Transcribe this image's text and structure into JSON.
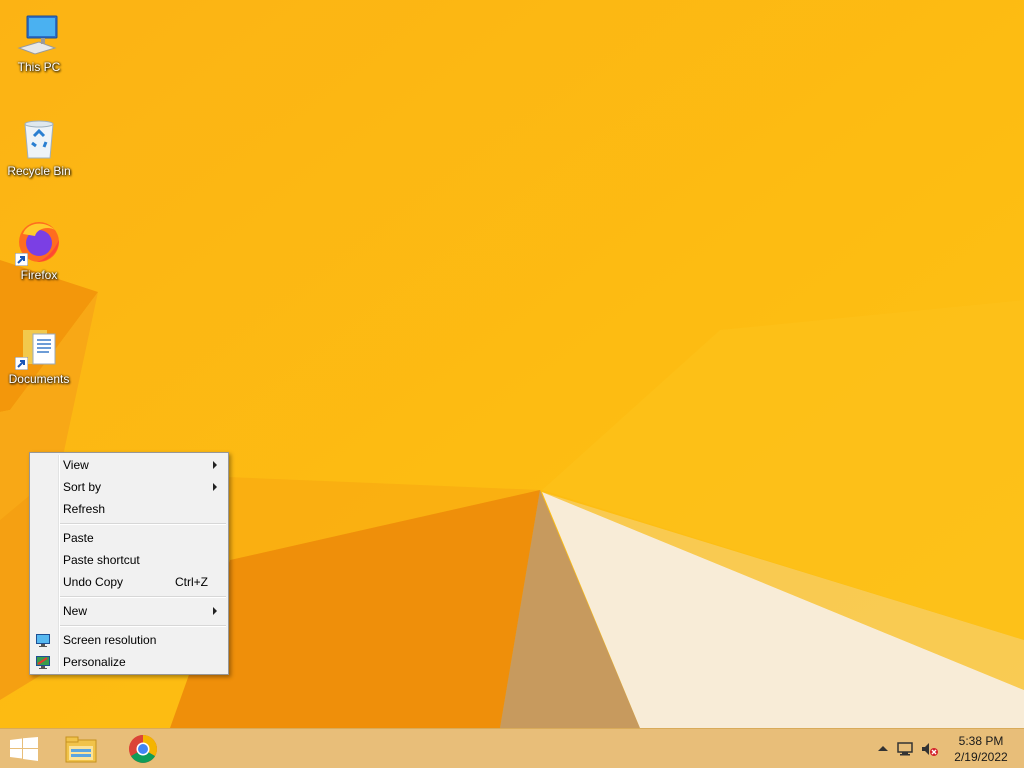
{
  "desktop": {
    "icons": [
      {
        "label": "This PC",
        "icon": "computer-icon"
      },
      {
        "label": "Recycle Bin",
        "icon": "recycle-bin-icon"
      },
      {
        "label": "Firefox",
        "icon": "firefox-icon"
      },
      {
        "label": "Documents",
        "icon": "documents-icon"
      }
    ]
  },
  "context_menu": {
    "items": [
      {
        "label": "View",
        "submenu": true
      },
      {
        "label": "Sort by",
        "submenu": true
      },
      {
        "label": "Refresh"
      },
      {
        "label": "Paste"
      },
      {
        "label": "Paste shortcut"
      },
      {
        "label": "Undo Copy",
        "shortcut": "Ctrl+Z"
      },
      {
        "label": "New",
        "submenu": true
      },
      {
        "label": "Screen resolution",
        "icon": "screen-resolution-icon"
      },
      {
        "label": "Personalize",
        "icon": "personalize-icon"
      }
    ]
  },
  "taskbar": {
    "pinned": [
      "start-icon",
      "file-explorer-icon",
      "chrome-icon"
    ],
    "tray": [
      "show-hidden-icons-icon",
      "network-icon",
      "volume-muted-icon"
    ],
    "clock": {
      "time": "5:38 PM",
      "date": "2/19/2022"
    }
  },
  "colors": {
    "wallpaper_base": "#fdbb12",
    "wallpaper_dark": "#f08c0a",
    "wallpaper_light": "#f9ecd9",
    "menu_bg": "#f1f1f1",
    "taskbar_bg": "#e8be79"
  }
}
